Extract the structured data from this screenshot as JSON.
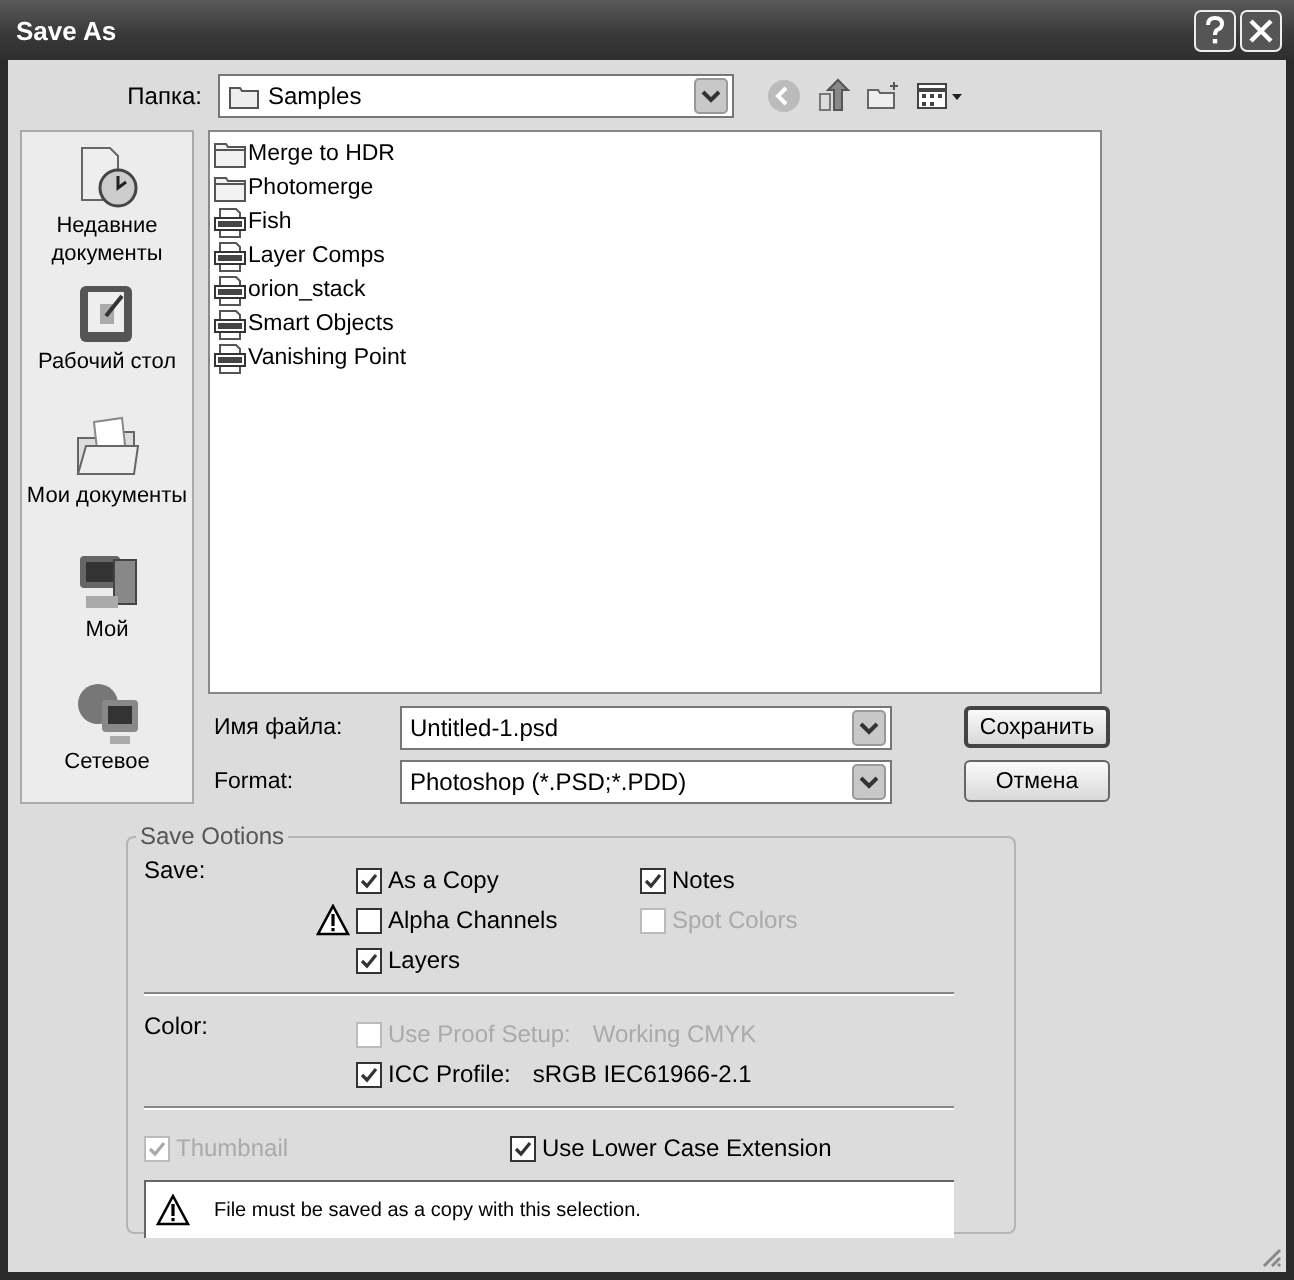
{
  "window": {
    "title": "Save As"
  },
  "folder": {
    "label": "Папка:",
    "value": "Samples"
  },
  "places": [
    {
      "label": "Недавние документы",
      "kind": "recent"
    },
    {
      "label": "Рабочий стол",
      "kind": "desktop"
    },
    {
      "label": "Мои документы",
      "kind": "documents"
    },
    {
      "label": "Мой",
      "kind": "computer"
    },
    {
      "label": "Сетевое",
      "kind": "network"
    }
  ],
  "files": [
    {
      "name": "Merge to HDR",
      "kind": "folder"
    },
    {
      "name": "Photomerge",
      "kind": "folder"
    },
    {
      "name": "Fish",
      "kind": "psd"
    },
    {
      "name": "Layer Comps",
      "kind": "psd"
    },
    {
      "name": "orion_stack",
      "kind": "psd"
    },
    {
      "name": "Smart Objects",
      "kind": "psd"
    },
    {
      "name": "Vanishing Point",
      "kind": "psd"
    }
  ],
  "filename": {
    "label": "Имя файла:",
    "value": "Untitled-1.psd"
  },
  "format": {
    "label": "Format:",
    "value": "Photoshop (*.PSD;*.PDD)"
  },
  "buttons": [
    {
      "label": "Сохранить",
      "default": true
    },
    {
      "label": "Отмена",
      "default": false
    }
  ],
  "save_options": {
    "title": "Save Ootions",
    "save": {
      "label": "Save:",
      "options": [
        {
          "label": "As a Copy",
          "checked": true,
          "disabled": false,
          "warning": false
        },
        {
          "label": "Notes",
          "checked": true,
          "disabled": false,
          "warning": false
        },
        {
          "label": "Alpha Channels",
          "checked": false,
          "disabled": false,
          "warning": true
        },
        {
          "label": "Spot Colors",
          "checked": false,
          "disabled": true,
          "warning": false
        },
        {
          "label": "Layers",
          "checked": true,
          "disabled": false,
          "warning": false
        }
      ]
    },
    "color": {
      "label": "Color:",
      "options": [
        {
          "label": "Use Proof Setup:",
          "value": "Working CMYK",
          "checked": false,
          "disabled": true
        },
        {
          "label": "ICC Profile:",
          "value": "sRGB IEC61966-2.1",
          "checked": true,
          "disabled": false
        }
      ]
    },
    "thumbnail": {
      "label": "Thumbnail",
      "checked": true,
      "disabled": true
    },
    "lower_case": {
      "label": "Use Lower Case Extension",
      "checked": true,
      "disabled": false
    },
    "message": "File must be saved as a copy with this selection."
  }
}
